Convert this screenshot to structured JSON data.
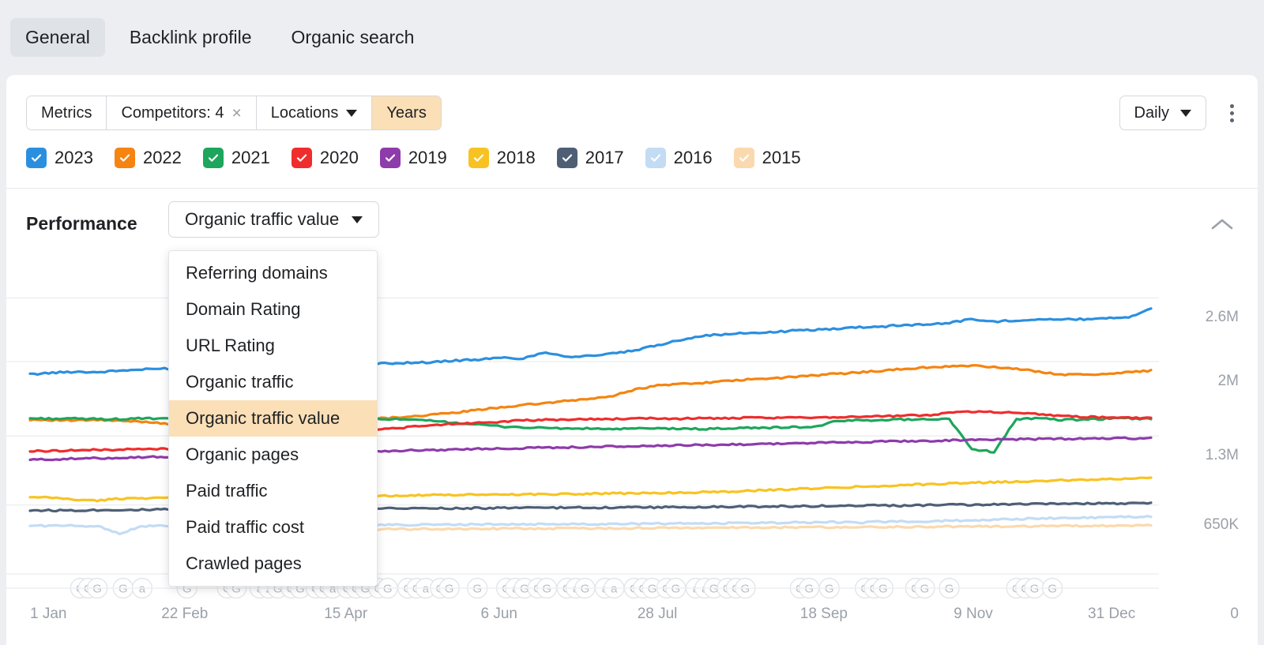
{
  "tabs": [
    {
      "label": "General",
      "active": true
    },
    {
      "label": "Backlink profile",
      "active": false
    },
    {
      "label": "Organic search",
      "active": false
    }
  ],
  "toolbar": {
    "metrics_label": "Metrics",
    "competitors_label": "Competitors: 4",
    "close_icon": "×",
    "locations_label": "Locations",
    "years_label": "Years",
    "daily_label": "Daily",
    "kebab_icon": "more-vertical-icon"
  },
  "years": [
    {
      "label": "2023",
      "color": "#2b8fdf",
      "checked": true
    },
    {
      "label": "2022",
      "color": "#f58410",
      "checked": true
    },
    {
      "label": "2021",
      "color": "#1da65c",
      "checked": true
    },
    {
      "label": "2020",
      "color": "#ef2d2d",
      "checked": true
    },
    {
      "label": "2019",
      "color": "#8e3bab",
      "checked": true
    },
    {
      "label": "2018",
      "color": "#f8c322",
      "checked": true
    },
    {
      "label": "2017",
      "color": "#4e5f75",
      "checked": true
    },
    {
      "label": "2016",
      "color": "#c3dcf4",
      "checked": true
    },
    {
      "label": "2015",
      "color": "#fbd9ae",
      "checked": true
    }
  ],
  "performance": {
    "title": "Performance",
    "selected_metric": "Organic traffic value",
    "collapse_icon": "chevron-up-icon",
    "menu_items": [
      {
        "label": "Referring domains",
        "selected": false
      },
      {
        "label": "Domain Rating",
        "selected": false
      },
      {
        "label": "URL Rating",
        "selected": false
      },
      {
        "label": "Organic traffic",
        "selected": false
      },
      {
        "label": "Organic traffic value",
        "selected": true
      },
      {
        "label": "Organic pages",
        "selected": false
      },
      {
        "label": "Paid traffic",
        "selected": false
      },
      {
        "label": "Paid traffic cost",
        "selected": false
      },
      {
        "label": "Crawled pages",
        "selected": false
      }
    ]
  },
  "chart_data": {
    "type": "line",
    "title": "Performance — Organic traffic value",
    "xlabel": "",
    "ylabel": "",
    "grid": true,
    "legend_position": "top",
    "ylim": [
      0,
      2900000
    ],
    "ytick_labels": [
      "2.6M",
      "2M",
      "1.3M",
      "650K",
      "0"
    ],
    "ytick_values": [
      2600000,
      2000000,
      1300000,
      650000,
      0
    ],
    "xtick_labels": [
      "1 Jan",
      "22 Feb",
      "15 Apr",
      "6 Jun",
      "28 Jul",
      "18 Sep",
      "9 Nov",
      "31 Dec"
    ],
    "x_fractions": [
      0.0,
      0.1425,
      0.2877,
      0.4274,
      0.5671,
      0.7123,
      0.8493,
      1.0
    ],
    "x": [
      0,
      0.02,
      0.04,
      0.06,
      0.08,
      0.1,
      0.12,
      0.14,
      0.16,
      0.18,
      0.2,
      0.22,
      0.24,
      0.26,
      0.28,
      0.3,
      0.32,
      0.34,
      0.36,
      0.38,
      0.4,
      0.42,
      0.44,
      0.46,
      0.48,
      0.5,
      0.52,
      0.54,
      0.56,
      0.58,
      0.6,
      0.62,
      0.64,
      0.66,
      0.68,
      0.7,
      0.72,
      0.74,
      0.76,
      0.78,
      0.8,
      0.82,
      0.84,
      0.86,
      0.88,
      0.9,
      0.92,
      0.94,
      0.96,
      0.98,
      1.0
    ],
    "series": [
      {
        "name": "2023",
        "color": "#2b8fdf",
        "values": [
          1880000,
          1895000,
          1905000,
          1900000,
          1915000,
          1925000,
          1935000,
          1930000,
          1950000,
          1965000,
          1975000,
          1970000,
          1965000,
          1960000,
          1945000,
          1970000,
          1985000,
          1990000,
          1995000,
          2010000,
          2020000,
          2035000,
          2030000,
          2090000,
          2045000,
          2055000,
          2075000,
          2105000,
          2155000,
          2205000,
          2245000,
          2255000,
          2270000,
          2275000,
          2290000,
          2300000,
          2310000,
          2325000,
          2330000,
          2345000,
          2350000,
          2365000,
          2400000,
          2375000,
          2390000,
          2400000,
          2395000,
          2400000,
          2410000,
          2420000,
          2500000
        ]
      },
      {
        "name": "2022",
        "color": "#f58410",
        "values": [
          1455000,
          1450000,
          1445000,
          1450000,
          1440000,
          1435000,
          1420000,
          1390000,
          1430000,
          1438000,
          1440000,
          1443000,
          1445000,
          1450000,
          1455000,
          1460000,
          1470000,
          1485000,
          1500000,
          1520000,
          1545000,
          1570000,
          1590000,
          1610000,
          1630000,
          1650000,
          1675000,
          1740000,
          1775000,
          1790000,
          1800000,
          1815000,
          1830000,
          1840000,
          1855000,
          1870000,
          1885000,
          1900000,
          1915000,
          1930000,
          1945000,
          1955000,
          1960000,
          1950000,
          1930000,
          1905000,
          1880000,
          1875000,
          1885000,
          1900000,
          1915000
        ]
      },
      {
        "name": "2021",
        "color": "#1da65c",
        "values": [
          1465000,
          1463000,
          1462000,
          1460000,
          1458000,
          1465000,
          1460000,
          1455000,
          1462000,
          1465000,
          1463000,
          1466000,
          1468000,
          1470000,
          1468000,
          1465000,
          1460000,
          1450000,
          1440000,
          1425000,
          1405000,
          1390000,
          1380000,
          1375000,
          1370000,
          1368000,
          1365000,
          1368000,
          1370000,
          1368000,
          1365000,
          1370000,
          1375000,
          1378000,
          1382000,
          1385000,
          1440000,
          1448000,
          1452000,
          1455000,
          1458000,
          1460000,
          1175000,
          1150000,
          1460000,
          1465000,
          1450000,
          1455000,
          1460000,
          1465000,
          1462000
        ]
      },
      {
        "name": "2020",
        "color": "#ef2d2d",
        "values": [
          1155000,
          1160000,
          1165000,
          1168000,
          1172000,
          1175000,
          1178000,
          1185000,
          1215000,
          1240000,
          1258000,
          1272000,
          1290000,
          1310000,
          1330000,
          1350000,
          1368000,
          1385000,
          1400000,
          1415000,
          1425000,
          1435000,
          1445000,
          1450000,
          1455000,
          1458000,
          1460000,
          1462000,
          1465000,
          1462000,
          1468000,
          1465000,
          1470000,
          1468000,
          1472000,
          1475000,
          1478000,
          1482000,
          1485000,
          1490000,
          1495000,
          1520000,
          1530000,
          1525000,
          1520000,
          1505000,
          1490000,
          1480000,
          1475000,
          1470000,
          1468000
        ]
      },
      {
        "name": "2019",
        "color": "#8e3bab",
        "values": [
          1075000,
          1080000,
          1085000,
          1090000,
          1095000,
          1100000,
          1103000,
          1108000,
          1112000,
          1118000,
          1125000,
          1130000,
          1135000,
          1140000,
          1148000,
          1152000,
          1158000,
          1163000,
          1168000,
          1172000,
          1178000,
          1182000,
          1186000,
          1190000,
          1193000,
          1196000,
          1200000,
          1203000,
          1206000,
          1210000,
          1215000,
          1218000,
          1222000,
          1226000,
          1230000,
          1234000,
          1238000,
          1242000,
          1246000,
          1250000,
          1254000,
          1258000,
          1262000,
          1266000,
          1268000,
          1270000,
          1272000,
          1274000,
          1276000,
          1278000,
          1280000
        ]
      },
      {
        "name": "2018",
        "color": "#f8c322",
        "values": [
          720000,
          718000,
          700000,
          690000,
          710000,
          715000,
          717000,
          718000,
          720000,
          722000,
          724000,
          726000,
          728000,
          730000,
          733000,
          735000,
          738000,
          740000,
          742000,
          744000,
          746000,
          748000,
          750000,
          752000,
          754000,
          756000,
          758000,
          760000,
          763000,
          766000,
          770000,
          776000,
          782000,
          790000,
          798000,
          806000,
          814000,
          822000,
          830000,
          838000,
          845000,
          852000,
          858000,
          864000,
          870000,
          876000,
          882000,
          888000,
          894000,
          900000,
          906000
        ]
      },
      {
        "name": "2017",
        "color": "#4e5f75",
        "values": [
          600000,
          598000,
          600000,
          602000,
          604000,
          605000,
          606000,
          607000,
          608000,
          609000,
          610000,
          611000,
          612000,
          613000,
          614000,
          615000,
          616000,
          617000,
          618000,
          619000,
          620000,
          621000,
          622000,
          623000,
          624000,
          625000,
          626000,
          627000,
          628000,
          629000,
          630000,
          632000,
          634000,
          636000,
          638000,
          640000,
          642000,
          644000,
          646000,
          642000,
          648000,
          650000,
          652000,
          654000,
          656000,
          658000,
          660000,
          662000,
          664000,
          666000,
          668000
        ]
      },
      {
        "name": "2016",
        "color": "#c3dcf4",
        "values": [
          455000,
          454000,
          453000,
          452000,
          380000,
          450000,
          452000,
          453000,
          454000,
          455000,
          456000,
          457000,
          458000,
          459000,
          460000,
          461000,
          462000,
          463000,
          464000,
          465000,
          466000,
          467000,
          468000,
          469000,
          470000,
          471000,
          472000,
          473000,
          474000,
          475000,
          476000,
          478000,
          480000,
          482000,
          484000,
          486000,
          488000,
          482000,
          492000,
          494000,
          496000,
          500000,
          506000,
          512000,
          518000,
          522000,
          526000,
          530000,
          534000,
          538000,
          542000
        ]
      },
      {
        "name": "2015",
        "color": "#fbd9ae",
        "values": [
          null,
          null,
          null,
          null,
          null,
          null,
          null,
          null,
          null,
          null,
          null,
          null,
          null,
          null,
          null,
          420000,
          421000,
          422000,
          423000,
          424000,
          425000,
          426000,
          427000,
          428000,
          429000,
          430000,
          431000,
          432000,
          433000,
          434000,
          435000,
          436000,
          437000,
          438000,
          439000,
          440000,
          441000,
          442000,
          443000,
          444000,
          445000,
          446000,
          447000,
          448000,
          449000,
          450000,
          451000,
          452000,
          453000,
          454000,
          455000
        ]
      }
    ]
  },
  "algo_updates": {
    "google_letter": "G",
    "ahrefs_letter": "a",
    "positions": [
      {
        "x": 0.045,
        "t": "G"
      },
      {
        "x": 0.052,
        "t": "G"
      },
      {
        "x": 0.06,
        "t": "G"
      },
      {
        "x": 0.083,
        "t": "G"
      },
      {
        "x": 0.1,
        "t": "a"
      },
      {
        "x": 0.14,
        "t": "G"
      },
      {
        "x": 0.176,
        "t": "G"
      },
      {
        "x": 0.184,
        "t": "G"
      },
      {
        "x": 0.205,
        "t": "a"
      },
      {
        "x": 0.213,
        "t": "2"
      },
      {
        "x": 0.221,
        "t": "G"
      },
      {
        "x": 0.233,
        "t": "G"
      },
      {
        "x": 0.241,
        "t": "G"
      },
      {
        "x": 0.255,
        "t": "G"
      },
      {
        "x": 0.262,
        "t": "G"
      },
      {
        "x": 0.27,
        "t": "a"
      },
      {
        "x": 0.283,
        "t": "G"
      },
      {
        "x": 0.291,
        "t": "G"
      },
      {
        "x": 0.299,
        "t": "G"
      },
      {
        "x": 0.311,
        "t": "G"
      },
      {
        "x": 0.319,
        "t": "G"
      },
      {
        "x": 0.337,
        "t": "G"
      },
      {
        "x": 0.345,
        "t": "G"
      },
      {
        "x": 0.353,
        "t": "a"
      },
      {
        "x": 0.366,
        "t": "G"
      },
      {
        "x": 0.374,
        "t": "G"
      },
      {
        "x": 0.399,
        "t": "G"
      },
      {
        "x": 0.425,
        "t": "G"
      },
      {
        "x": 0.433,
        "t": "a"
      },
      {
        "x": 0.441,
        "t": "G"
      },
      {
        "x": 0.453,
        "t": "G"
      },
      {
        "x": 0.461,
        "t": "G"
      },
      {
        "x": 0.479,
        "t": "G"
      },
      {
        "x": 0.487,
        "t": "a"
      },
      {
        "x": 0.495,
        "t": "G"
      },
      {
        "x": 0.513,
        "t": "a"
      },
      {
        "x": 0.521,
        "t": "a"
      },
      {
        "x": 0.539,
        "t": "G"
      },
      {
        "x": 0.547,
        "t": "G"
      },
      {
        "x": 0.555,
        "t": "G"
      },
      {
        "x": 0.568,
        "t": "G"
      },
      {
        "x": 0.576,
        "t": "G"
      },
      {
        "x": 0.594,
        "t": "a"
      },
      {
        "x": 0.602,
        "t": "a"
      },
      {
        "x": 0.61,
        "t": "G"
      },
      {
        "x": 0.622,
        "t": "G"
      },
      {
        "x": 0.63,
        "t": "G"
      },
      {
        "x": 0.638,
        "t": "G"
      },
      {
        "x": 0.687,
        "t": "G"
      },
      {
        "x": 0.695,
        "t": "G"
      },
      {
        "x": 0.713,
        "t": "G"
      },
      {
        "x": 0.745,
        "t": "G"
      },
      {
        "x": 0.753,
        "t": "G"
      },
      {
        "x": 0.761,
        "t": "G"
      },
      {
        "x": 0.79,
        "t": "G"
      },
      {
        "x": 0.798,
        "t": "G"
      },
      {
        "x": 0.82,
        "t": "G"
      },
      {
        "x": 0.88,
        "t": "G"
      },
      {
        "x": 0.888,
        "t": "G"
      },
      {
        "x": 0.896,
        "t": "G"
      },
      {
        "x": 0.912,
        "t": "G"
      }
    ]
  }
}
